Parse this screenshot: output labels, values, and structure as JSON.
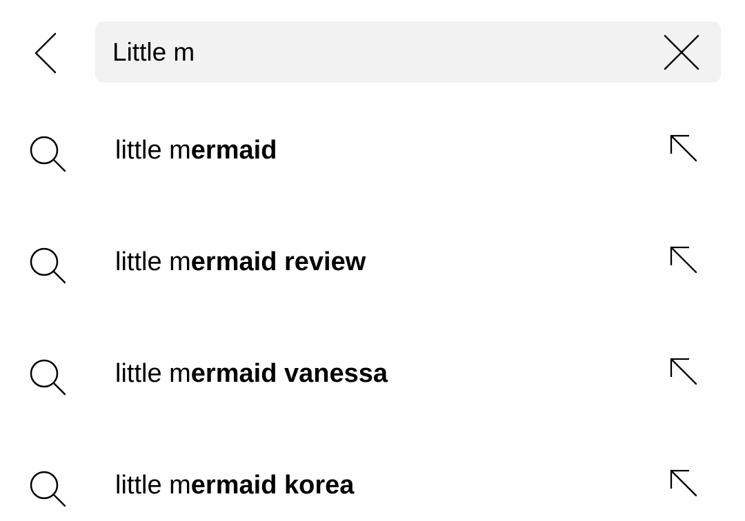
{
  "header": {
    "back_icon": "chevron-left-icon",
    "clear_icon": "close-icon"
  },
  "search": {
    "value": "Little m",
    "background_color": "#f2f2f2"
  },
  "suggestions": [
    {
      "typed": "little m",
      "completion": "ermaid",
      "icon": "search-icon",
      "action_icon": "arrow-up-left-icon"
    },
    {
      "typed": "little m",
      "completion": "ermaid review",
      "icon": "search-icon",
      "action_icon": "arrow-up-left-icon"
    },
    {
      "typed": "little m",
      "completion": "ermaid vanessa",
      "icon": "search-icon",
      "action_icon": "arrow-up-left-icon"
    },
    {
      "typed": "little m",
      "completion": "ermaid korea",
      "icon": "search-icon",
      "action_icon": "arrow-up-left-icon"
    }
  ]
}
